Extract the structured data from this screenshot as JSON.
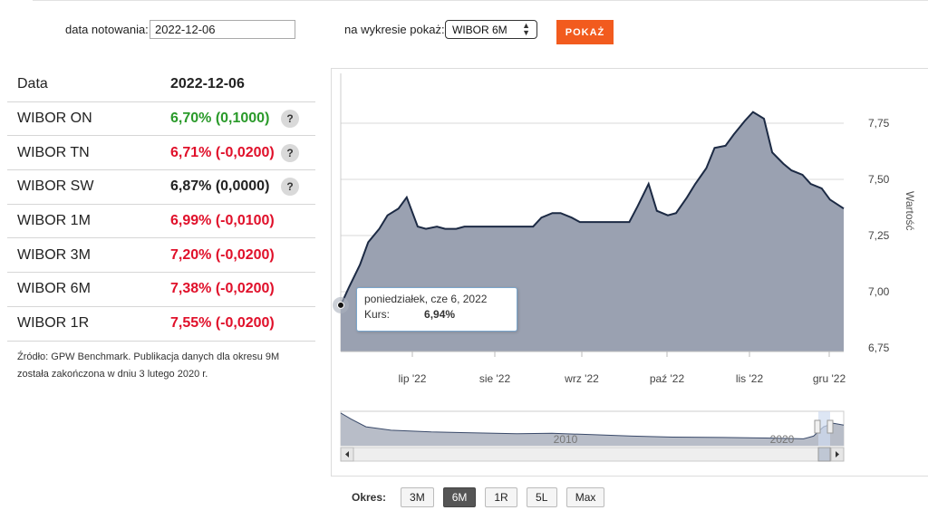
{
  "form": {
    "date_label": "data notowania:",
    "date_value": "2022-12-06",
    "show_label": "na wykresie pokaż:",
    "selected_rate": "WIBOR 6M",
    "submit_label": "POKAŻ"
  },
  "table": {
    "header": {
      "name": "Data",
      "value": "2022-12-06"
    },
    "rows": [
      {
        "name": "WIBOR ON",
        "value": "6,70% (0,1000)",
        "help": "?"
      },
      {
        "name": "WIBOR TN",
        "value": "6,71% (-0,0200)",
        "help": "?"
      },
      {
        "name": "WIBOR SW",
        "value": "6,87% (0,0000)",
        "help": "?"
      },
      {
        "name": "WIBOR 1M",
        "value": "6,99% (-0,0100)"
      },
      {
        "name": "WIBOR 3M",
        "value": "7,20% (-0,0200)"
      },
      {
        "name": "WIBOR 6M",
        "value": "7,38% (-0,0200)"
      },
      {
        "name": "WIBOR 1R",
        "value": "7,55% (-0,0200)"
      }
    ]
  },
  "source_note": "Źródło: GPW Benchmark. Publikacja danych dla okresu 9M została zakończona w dniu 3 lutego 2020 r.",
  "tooltip": {
    "date": "poniedziałek, cze 6, 2022",
    "label": "Kurs:",
    "value": "6,94%"
  },
  "period": {
    "label": "Okres:",
    "buttons": [
      "3M",
      "6M",
      "1R",
      "5L",
      "Max"
    ],
    "active": "6M"
  },
  "colors": {
    "area_fill": "#9aa1b1",
    "line": "#1c2a44",
    "positive": "#2a9a2a",
    "negative": "#e0102a",
    "accent_button": "#f25b1e"
  },
  "chart_data": {
    "type": "area",
    "ylabel": "Wartość",
    "yticks": [
      "6,75",
      "7,00",
      "7,25",
      "7,50",
      "7,75"
    ],
    "ylim": [
      6.75,
      7.9
    ],
    "xticks": [
      "lip '22",
      "sie '22",
      "wrz '22",
      "paź '22",
      "lis '22",
      "gru '22"
    ],
    "grid": true,
    "series": [
      {
        "x": [
          "2022-06-06",
          "2022-06-09",
          "2022-06-13",
          "2022-06-16",
          "2022-06-20",
          "2022-06-23",
          "2022-06-27",
          "2022-06-30",
          "2022-07-04",
          "2022-07-07",
          "2022-07-11",
          "2022-07-14",
          "2022-07-18",
          "2022-07-21",
          "2022-07-25",
          "2022-07-28",
          "2022-08-01",
          "2022-08-04",
          "2022-08-08",
          "2022-08-11",
          "2022-08-15",
          "2022-08-18",
          "2022-08-22",
          "2022-08-25",
          "2022-08-29",
          "2022-09-01",
          "2022-09-05",
          "2022-09-08",
          "2022-09-12",
          "2022-09-15",
          "2022-09-19",
          "2022-09-22",
          "2022-09-26",
          "2022-09-29",
          "2022-10-03",
          "2022-10-06",
          "2022-10-10",
          "2022-10-13",
          "2022-10-17",
          "2022-10-20",
          "2022-10-24",
          "2022-10-27",
          "2022-10-31",
          "2022-11-03",
          "2022-11-07",
          "2022-11-10",
          "2022-11-14",
          "2022-11-17",
          "2022-11-21",
          "2022-11-24",
          "2022-11-28",
          "2022-12-01",
          "2022-12-06"
        ],
        "y": [
          6.94,
          7.02,
          7.12,
          7.22,
          7.28,
          7.34,
          7.37,
          7.42,
          7.29,
          7.28,
          7.29,
          7.28,
          7.28,
          7.29,
          7.29,
          7.29,
          7.29,
          7.29,
          7.29,
          7.29,
          7.29,
          7.33,
          7.35,
          7.35,
          7.33,
          7.31,
          7.31,
          7.31,
          7.31,
          7.31,
          7.31,
          7.38,
          7.48,
          7.36,
          7.34,
          7.35,
          7.42,
          7.48,
          7.55,
          7.64,
          7.65,
          7.7,
          7.76,
          7.8,
          7.77,
          7.62,
          7.57,
          7.54,
          7.52,
          7.48,
          7.46,
          7.41,
          7.37
        ]
      }
    ],
    "navigator": {
      "labels": [
        "2010",
        "2020"
      ]
    }
  }
}
